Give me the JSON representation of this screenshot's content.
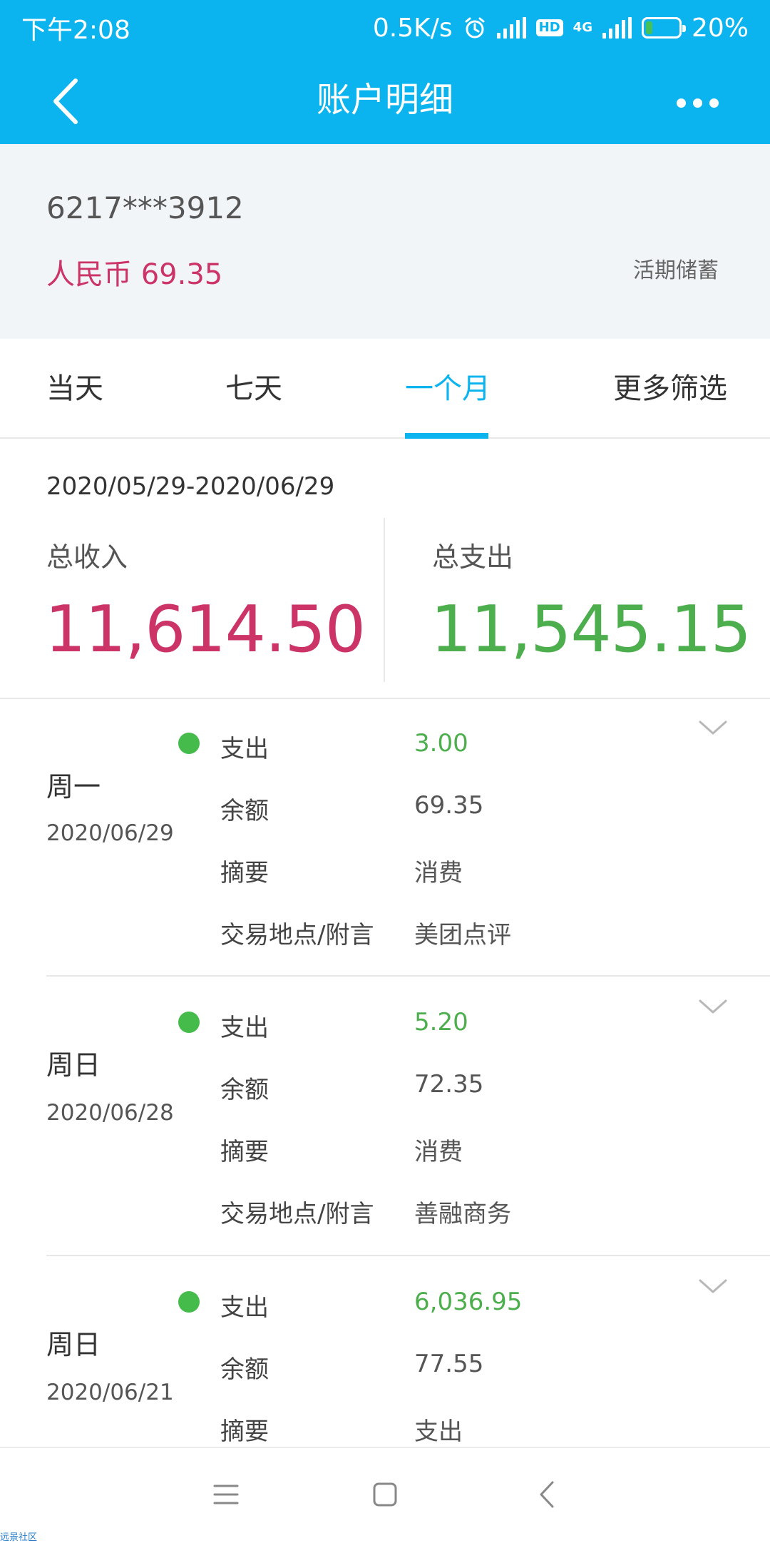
{
  "status_bar": {
    "time": "下午2:08",
    "speed": "0.5K/s",
    "hd_label": "HD",
    "network_label": "4G",
    "battery_percent": "20%",
    "battery_level": 0.2
  },
  "nav": {
    "title": "账户明细"
  },
  "account": {
    "number": "6217***3912",
    "balance": "人民币 69.35",
    "type": "活期储蓄"
  },
  "tabs": [
    {
      "label": "当天",
      "active": false
    },
    {
      "label": "七天",
      "active": false
    },
    {
      "label": "一个月",
      "active": true
    },
    {
      "label": "更多筛选",
      "active": false
    }
  ],
  "summary": {
    "date_range": "2020/05/29-2020/06/29",
    "income_label": "总收入",
    "income_value": "11,614.50",
    "expense_label": "总支出",
    "expense_value": "11,545.15"
  },
  "transactions": [
    {
      "weekday": "周一",
      "date": "2020/06/29",
      "rows": [
        {
          "label": "支出",
          "value": "3.00"
        },
        {
          "label": "余额",
          "value": "69.35"
        },
        {
          "label": "摘要",
          "value": "消费"
        },
        {
          "label": "交易地点/附言",
          "value": "美团点评"
        }
      ]
    },
    {
      "weekday": "周日",
      "date": "2020/06/28",
      "rows": [
        {
          "label": "支出",
          "value": "5.20"
        },
        {
          "label": "余额",
          "value": "72.35"
        },
        {
          "label": "摘要",
          "value": "消费"
        },
        {
          "label": "交易地点/附言",
          "value": "善融商务"
        }
      ]
    },
    {
      "weekday": "周日",
      "date": "2020/06/21",
      "rows": [
        {
          "label": "支出",
          "value": "6,036.95"
        },
        {
          "label": "余额",
          "value": "77.55"
        },
        {
          "label": "摘要",
          "value": "支出"
        }
      ]
    }
  ],
  "colors": {
    "header": "#0bb4ee",
    "income": "#cc3366",
    "expense": "#4cae4c",
    "dot": "#45bb4c"
  },
  "icons": {
    "back": "chevron-left-icon",
    "more": "more-dots-icon",
    "expand": "chevron-down-icon",
    "menu": "menu-icon",
    "home": "square-home-icon",
    "nav_back": "chevron-left-icon"
  },
  "watermark": "远景社区"
}
